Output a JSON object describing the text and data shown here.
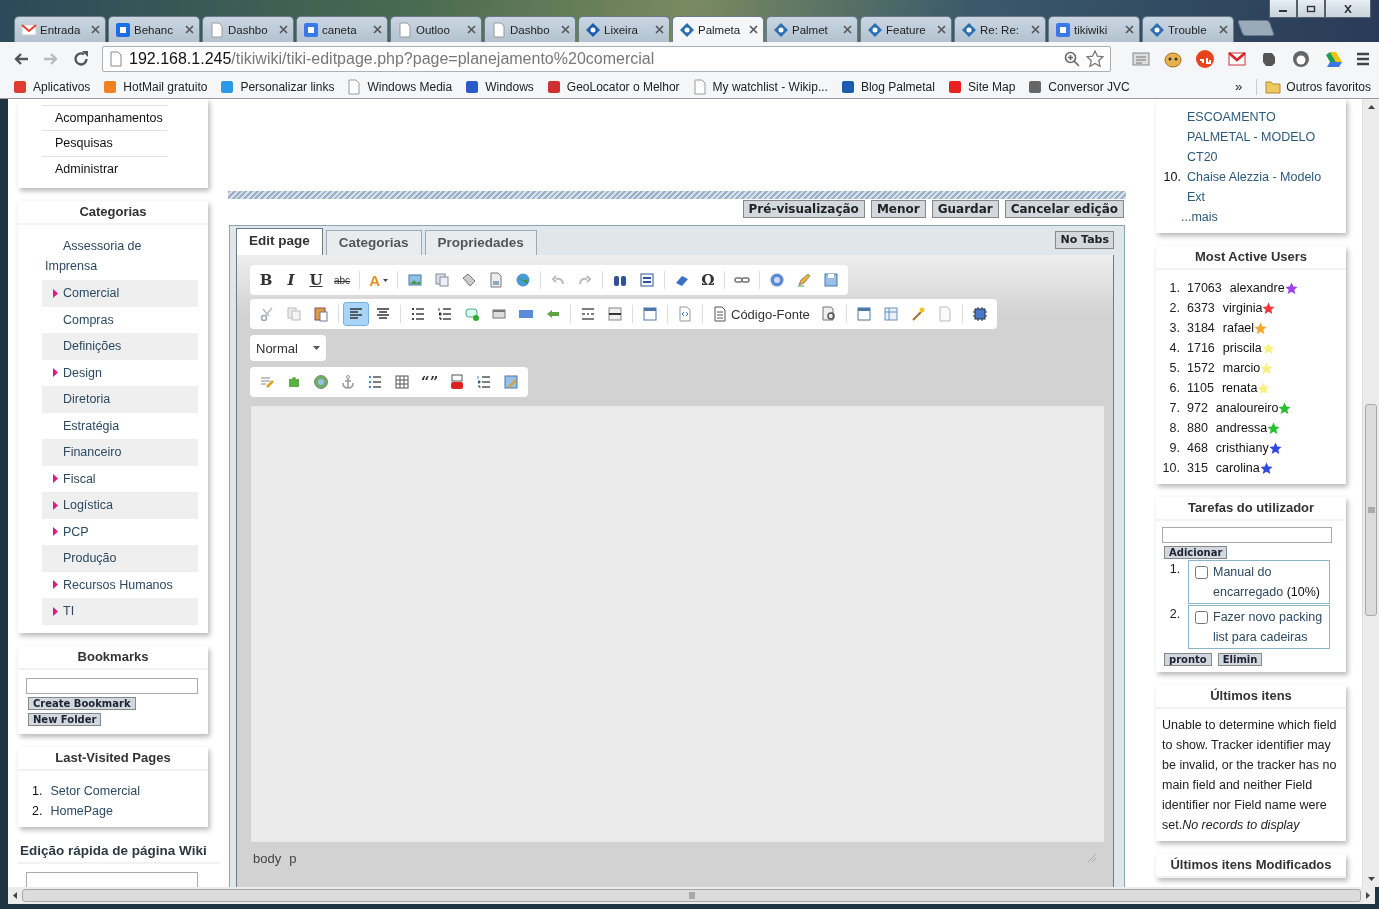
{
  "browser_tabs": [
    {
      "title": "Entrada",
      "selected": false
    },
    {
      "title": "Behanc",
      "selected": false
    },
    {
      "title": "Dashbo",
      "selected": false
    },
    {
      "title": "caneta",
      "selected": false
    },
    {
      "title": "Outloo",
      "selected": false
    },
    {
      "title": "Dashbo",
      "selected": false
    },
    {
      "title": "Lixeira",
      "selected": false
    },
    {
      "title": "Palmeta",
      "selected": true
    },
    {
      "title": "Palmet",
      "selected": false
    },
    {
      "title": "Feature",
      "selected": false
    },
    {
      "title": "Re: Re:",
      "selected": false
    },
    {
      "title": "tikiwiki",
      "selected": false
    },
    {
      "title": "Trouble",
      "selected": false
    }
  ],
  "address": {
    "host": "192.168.1.245",
    "path": "/tikiwiki/tiki-editpage.php?page=planejamento%20comercial"
  },
  "bookmarks": [
    {
      "label": "Aplicativos"
    },
    {
      "label": "HotMail gratuito"
    },
    {
      "label": "Personalizar links"
    },
    {
      "label": "Windows Media"
    },
    {
      "label": "Windows"
    },
    {
      "label": "GeoLocator o Melhor"
    },
    {
      "label": "My watchlist - Wikip..."
    },
    {
      "label": "Blog Palmetal"
    },
    {
      "label": "Site Map"
    },
    {
      "label": "Conversor JVC"
    }
  ],
  "bookmarks_more": "»",
  "other_bookmarks": "Outros favoritos",
  "left": {
    "menu": [
      "Acompanhamentos",
      "Pesquisas",
      "Administrar"
    ],
    "categories": {
      "title": "Categorias",
      "items": [
        {
          "label": "Assessoria de Imprensa",
          "expandable": false
        },
        {
          "label": "Comercial",
          "expandable": true
        },
        {
          "label": "Compras",
          "expandable": false
        },
        {
          "label": "Definições",
          "expandable": false
        },
        {
          "label": "Design",
          "expandable": true
        },
        {
          "label": "Diretoria",
          "expandable": false
        },
        {
          "label": "Estratégia",
          "expandable": false
        },
        {
          "label": "Financeiro",
          "expandable": false
        },
        {
          "label": "Fiscal",
          "expandable": true
        },
        {
          "label": "Logística",
          "expandable": true
        },
        {
          "label": "PCP",
          "expandable": true
        },
        {
          "label": "Produção",
          "expandable": false
        },
        {
          "label": "Recursos Humanos",
          "expandable": true
        },
        {
          "label": "TI",
          "expandable": true
        }
      ]
    },
    "bookmarks": {
      "title": "Bookmarks",
      "buttons": [
        "Create Bookmark",
        "New Folder"
      ]
    },
    "last_visited": {
      "title": "Last-Visited Pages",
      "items": [
        {
          "number": "1.",
          "label": "Setor Comercial"
        },
        {
          "number": "2.",
          "label": "HomePage"
        }
      ]
    },
    "quick_edit": {
      "title": "Edição rápida de página Wiki"
    }
  },
  "center": {
    "actions": [
      "Pré-visualização",
      "Menor",
      "Guardar",
      "Cancelar edição"
    ],
    "tabs": [
      {
        "label": "Edit page",
        "selected": true
      },
      {
        "label": "Categorias",
        "selected": false
      },
      {
        "label": "Propriedades",
        "selected": false
      }
    ],
    "no_tabs": "No Tabs",
    "toolbars": [
      [
        {
          "kind": "glyph",
          "label": "B",
          "pressed": false
        },
        {
          "kind": "glyph",
          "label": "I",
          "pressed": false
        },
        {
          "kind": "glyph",
          "label": "U",
          "pressed": false
        },
        {
          "kind": "glyph",
          "label": "abc",
          "pressed": false
        },
        {
          "kind": "sep"
        },
        {
          "kind": "menu",
          "label": "A",
          "pressed": false
        },
        {
          "kind": "sep"
        },
        {
          "kind": "icon",
          "pressed": false
        },
        {
          "kind": "icon",
          "pressed": false
        },
        {
          "kind": "icon",
          "pressed": false
        },
        {
          "kind": "icon",
          "pressed": false
        },
        {
          "kind": "icon",
          "pressed": false
        },
        {
          "kind": "sep"
        },
        {
          "kind": "icon",
          "pressed": false
        },
        {
          "kind": "icon",
          "pressed": false
        },
        {
          "kind": "sep"
        },
        {
          "kind": "icon",
          "pressed": false
        },
        {
          "kind": "icon",
          "pressed": false
        },
        {
          "kind": "sep"
        },
        {
          "kind": "icon",
          "pressed": false
        },
        {
          "kind": "glyph",
          "label": "Ω",
          "pressed": false
        },
        {
          "kind": "sep"
        },
        {
          "kind": "icon",
          "pressed": false
        },
        {
          "kind": "sep"
        },
        {
          "kind": "icon",
          "pressed": false
        },
        {
          "kind": "icon",
          "pressed": false
        },
        {
          "kind": "icon",
          "pressed": false
        }
      ],
      [
        {
          "kind": "icon",
          "pressed": false
        },
        {
          "kind": "icon",
          "pressed": false
        },
        {
          "kind": "icon",
          "pressed": false
        },
        {
          "kind": "sep"
        },
        {
          "kind": "icon",
          "pressed": true
        },
        {
          "kind": "icon",
          "pressed": false
        },
        {
          "kind": "sep"
        },
        {
          "kind": "icon",
          "pressed": false
        },
        {
          "kind": "icon",
          "pressed": false
        },
        {
          "kind": "icon",
          "pressed": false
        },
        {
          "kind": "icon",
          "pressed": false
        },
        {
          "kind": "icon",
          "pressed": false
        },
        {
          "kind": "icon",
          "pressed": false
        },
        {
          "kind": "sep"
        },
        {
          "kind": "icon",
          "pressed": false
        },
        {
          "kind": "icon",
          "pressed": false
        },
        {
          "kind": "sep"
        },
        {
          "kind": "icon",
          "pressed": false
        },
        {
          "kind": "sep"
        },
        {
          "kind": "icon",
          "pressed": false
        },
        {
          "kind": "sep"
        },
        {
          "kind": "text",
          "label": "Código-Fonte",
          "pressed": false
        },
        {
          "kind": "icon",
          "pressed": false
        },
        {
          "kind": "sep"
        },
        {
          "kind": "icon",
          "pressed": false
        },
        {
          "kind": "icon",
          "pressed": false
        },
        {
          "kind": "icon",
          "pressed": false
        },
        {
          "kind": "icon",
          "pressed": false
        },
        {
          "kind": "sep"
        },
        {
          "kind": "icon",
          "pressed": false
        }
      ],
      [
        {
          "kind": "select",
          "label": "Normal"
        }
      ],
      [
        {
          "kind": "icon",
          "pressed": false
        },
        {
          "kind": "icon",
          "pressed": false
        },
        {
          "kind": "icon",
          "pressed": false
        },
        {
          "kind": "icon",
          "pressed": false
        },
        {
          "kind": "icon",
          "pressed": false
        },
        {
          "kind": "icon",
          "pressed": false
        },
        {
          "kind": "glyph",
          "label": "“”",
          "pressed": false
        },
        {
          "kind": "icon",
          "pressed": false
        },
        {
          "kind": "icon",
          "pressed": false
        },
        {
          "kind": "icon",
          "pressed": false
        }
      ]
    ],
    "path": [
      "body",
      "p"
    ]
  },
  "right": {
    "recent": {
      "items": [
        {
          "text": "ESCOAMENTO PALMETAL - MODELO CT20"
        },
        {
          "number": "10.",
          "text": "Chaise Alezzia - Modelo Ext"
        }
      ],
      "more": "...mais"
    },
    "users": {
      "title": "Most Active Users",
      "items": [
        {
          "number": "1.",
          "score": "17063",
          "name": "alexandre",
          "color": "#a040e8"
        },
        {
          "number": "2.",
          "score": "6373",
          "name": "virginia",
          "color": "#f03838"
        },
        {
          "number": "3.",
          "score": "3184",
          "name": "rafael",
          "color": "#f4a828"
        },
        {
          "number": "4.",
          "score": "1716",
          "name": "priscila",
          "color": "#f8f080"
        },
        {
          "number": "5.",
          "score": "1572",
          "name": "marcio",
          "color": "#f8f080"
        },
        {
          "number": "6.",
          "score": "1105",
          "name": "renata",
          "color": "#f8f080"
        },
        {
          "number": "7.",
          "score": "972",
          "name": "analoureiro",
          "color": "#28c030"
        },
        {
          "number": "8.",
          "score": "880",
          "name": "andressa",
          "color": "#28c030"
        },
        {
          "number": "9.",
          "score": "468",
          "name": "cristhiany",
          "color": "#3048e0"
        },
        {
          "number": "10.",
          "score": "315",
          "name": "carolina",
          "color": "#3048e0"
        }
      ]
    },
    "tasks": {
      "title": "Tarefas do utilizador",
      "add": "Adicionar",
      "items": [
        {
          "number": "1.",
          "text": "Manual do encarregado",
          "progress": "(10%)",
          "checked": false
        },
        {
          "number": "2.",
          "text": "Fazer novo packing list para cadeiras",
          "checked": false
        }
      ],
      "buttons": [
        "pronto",
        "Elimin"
      ]
    },
    "last_items": {
      "title": "Últimos itens",
      "text": "Unable to determine which field to show. Tracker identifier may be invalid, or the tracker has no main field and neither Field identifier nor Field name were set.*No records to display*"
    },
    "last_modified": {
      "title": "Últimos itens Modificados"
    }
  }
}
